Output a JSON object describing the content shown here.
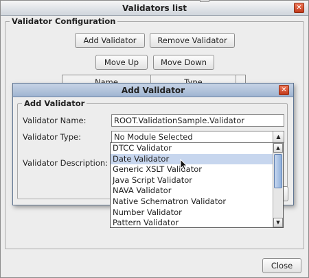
{
  "window": {
    "title": "Validators list",
    "close_glyph": "✕"
  },
  "config": {
    "group_label": "Validator Configuration",
    "add_label": "Add Validator",
    "remove_label": "Remove Validator",
    "move_up_label": "Move Up",
    "move_down_label": "Move Down",
    "columns": [
      "Name",
      "Type"
    ]
  },
  "dialog": {
    "title": "Add Validator",
    "close_glyph": "✕",
    "group_label": "Add Validator",
    "name_label": "Validator Name:",
    "name_value": "ROOT.ValidationSample.Validator",
    "type_label": "Validator Type:",
    "type_value": "No Module Selected",
    "description_label": "Validator Description:"
  },
  "dropdown": {
    "options": [
      "DTCC Validator",
      "Date Validator",
      "Generic XSLT Validator",
      "Java Script Validator",
      "NAVA Validator",
      "Native Schematron Validator",
      "Number Validator",
      "Pattern Validator"
    ],
    "highlighted": "Date Validator"
  },
  "footer": {
    "close_label": "Close"
  },
  "icons": {
    "window_close": "close-icon",
    "dialog_close": "close-icon",
    "combo_arrow": "chevron-up-icon",
    "scroll_up": "chevron-up-icon",
    "scroll_down": "chevron-down-icon",
    "pointer": "mouse-pointer-icon"
  },
  "colors": {
    "selection": "#c7d6ee",
    "dialog_title": "#b3c4dc",
    "close_button": "#d9542f"
  }
}
